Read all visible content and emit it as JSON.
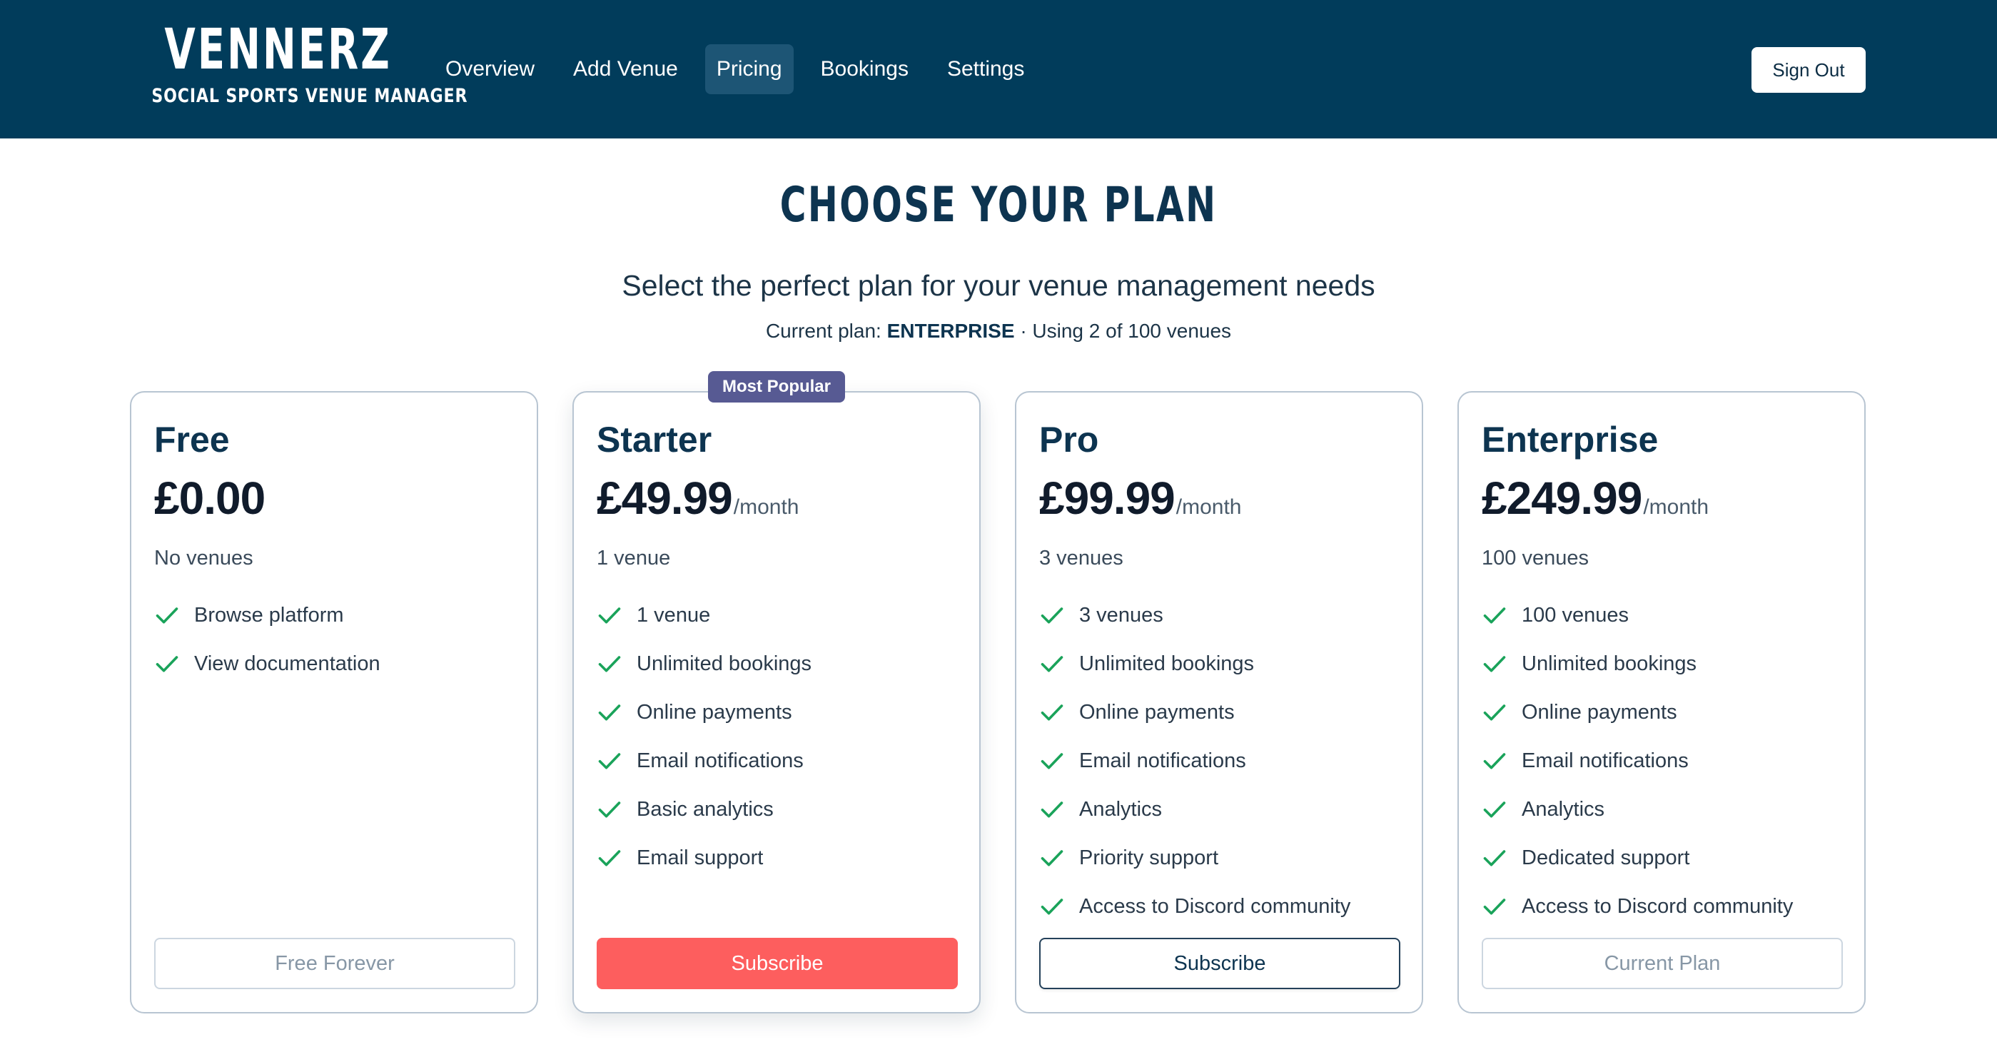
{
  "header": {
    "brand_name": "VENNERZ",
    "brand_tagline": "SOCIAL SPORTS VENUE MANAGER",
    "nav": [
      {
        "label": "Overview",
        "active": false
      },
      {
        "label": "Add Venue",
        "active": false
      },
      {
        "label": "Pricing",
        "active": true
      },
      {
        "label": "Bookings",
        "active": false
      },
      {
        "label": "Settings",
        "active": false
      }
    ],
    "sign_out_label": "Sign Out"
  },
  "hero": {
    "title": "CHOOSE YOUR PLAN",
    "subtitle": "Select the perfect plan for your venue management needs",
    "current_prefix": "Current plan:",
    "current_plan": "ENTERPRISE",
    "current_usage": "· Using 2 of 100 venues"
  },
  "plans": [
    {
      "name": "Free",
      "price": "£0.00",
      "period": "",
      "venue_summary": "No venues",
      "features": [
        "Browse platform",
        "View documentation"
      ],
      "button_label": "Free Forever",
      "button_style": "muted"
    },
    {
      "name": "Starter",
      "badge": "Most Popular",
      "price": "£49.99",
      "period": "/month",
      "venue_summary": "1 venue",
      "features": [
        "1 venue",
        "Unlimited bookings",
        "Online payments",
        "Email notifications",
        "Basic analytics",
        "Email support"
      ],
      "button_label": "Subscribe",
      "button_style": "primary"
    },
    {
      "name": "Pro",
      "price": "£99.99",
      "period": "/month",
      "venue_summary": "3 venues",
      "features": [
        "3 venues",
        "Unlimited bookings",
        "Online payments",
        "Email notifications",
        "Analytics",
        "Priority support",
        "Access to Discord community"
      ],
      "button_label": "Subscribe",
      "button_style": "outline"
    },
    {
      "name": "Enterprise",
      "price": "£249.99",
      "period": "/month",
      "venue_summary": "100 venues",
      "features": [
        "100 venues",
        "Unlimited bookings",
        "Online payments",
        "Email notifications",
        "Analytics",
        "Dedicated support",
        "Access to Discord community"
      ],
      "button_label": "Current Plan",
      "button_style": "muted"
    }
  ],
  "colors": {
    "header_bg": "#013c5b",
    "accent_red": "#fd5e5e",
    "badge_purple": "#575a93",
    "check_green": "#1aa35a",
    "heading_navy": "#0d3450"
  },
  "icons": {
    "feature_check": "check-icon"
  }
}
